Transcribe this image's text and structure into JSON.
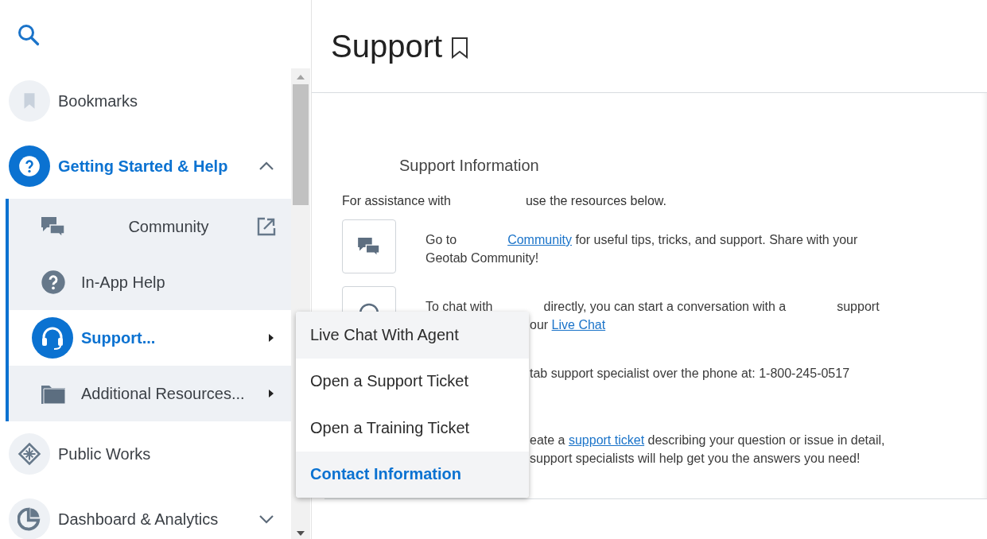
{
  "sidebar": {
    "items": [
      {
        "label": "Bookmarks",
        "kind": "bookmark",
        "selected": false
      },
      {
        "label": "Getting Started & Help",
        "kind": "help",
        "selected": true,
        "expanded": true,
        "children": [
          {
            "label": "Community",
            "kind": "chat",
            "selected": false,
            "external": true,
            "submenu": false
          },
          {
            "label": "In-App Help",
            "kind": "help",
            "selected": false,
            "external": false,
            "submenu": false
          },
          {
            "label": "Support...",
            "kind": "headset",
            "selected": true,
            "external": false,
            "submenu": true
          },
          {
            "label": "Additional Resources...",
            "kind": "folder",
            "selected": false,
            "external": false,
            "submenu": true
          }
        ]
      },
      {
        "label": "Public Works",
        "kind": "snowflake",
        "selected": false
      },
      {
        "label": "Dashboard & Analytics",
        "kind": "pie",
        "selected": false,
        "expanded": false
      }
    ]
  },
  "page": {
    "title": "Support",
    "section_heading": "Support Information",
    "intro": [
      [
        "For assistance with"
      ],
      [
        "use the resources below."
      ]
    ],
    "resources": [
      {
        "kind": "chat",
        "lines": [
          {
            "clipped": false,
            "chunks": [
              [
                {
                  "text": "Go to",
                  "link": false
                }
              ],
              [
                {
                  "text": "Community",
                  "link": true
                },
                {
                  "text": " for useful tips, tricks, and support. Share with your",
                  "link": false
                }
              ]
            ]
          },
          {
            "clipped": false,
            "chunks": [
              [
                {
                  "text": "Geotab Community!",
                  "link": false
                }
              ]
            ]
          }
        ]
      },
      {
        "kind": "bubble",
        "lines": [
          {
            "clipped": false,
            "chunks": [
              [
                {
                  "text": "To chat with",
                  "link": false
                }
              ],
              [
                {
                  "text": "directly, you can start a conversation with a",
                  "link": false
                }
              ],
              [
                {
                  "text": "support",
                  "link": false
                }
              ]
            ]
          },
          {
            "clipped": true,
            "chunks": [
              [
                {
                  "text": "our ",
                  "link": false
                },
                {
                  "text": "Live Chat",
                  "link": true
                }
              ]
            ]
          }
        ]
      },
      {
        "kind": "plain",
        "lines": [
          {
            "clipped": true,
            "chunks": [
              [
                {
                  "text": "tab support specialist over the phone at: 1-800-245-0517",
                  "link": false
                }
              ]
            ]
          }
        ]
      },
      {
        "kind": "plain",
        "lines": [
          {
            "clipped": true,
            "chunks": [
              [
                {
                  "text": "eate a ",
                  "link": false
                },
                {
                  "text": "support ticket",
                  "link": true
                },
                {
                  "text": " describing your question or issue in detail,",
                  "link": false
                }
              ]
            ]
          },
          {
            "clipped": true,
            "chunks": [
              [
                {
                  "text": "support specialists will help get you the answers you need!",
                  "link": false
                }
              ]
            ]
          }
        ]
      }
    ]
  },
  "menu": {
    "items": [
      {
        "label": "Live Chat With Agent",
        "hovered": true,
        "selected": false
      },
      {
        "label": "Open a Support Ticket",
        "hovered": false,
        "selected": false
      },
      {
        "label": "Open a Training Ticket",
        "hovered": false,
        "selected": false
      },
      {
        "label": "Contact Information",
        "hovered": false,
        "selected": true
      }
    ]
  }
}
